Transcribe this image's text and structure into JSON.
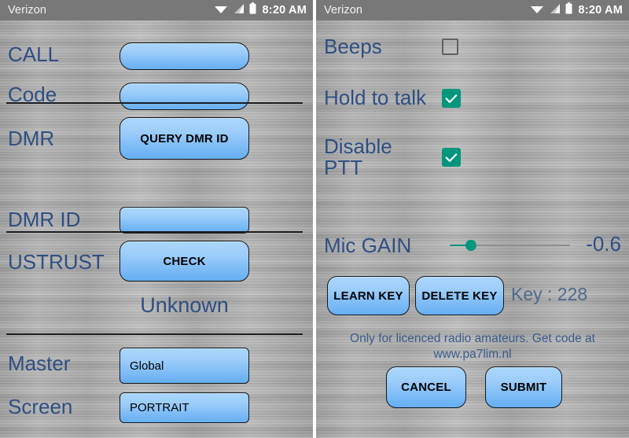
{
  "status_bar": {
    "carrier": "Verizon",
    "time": "8:20 AM",
    "icons": [
      "wifi-icon",
      "signal-icon",
      "battery-icon"
    ]
  },
  "left_panel": {
    "rows": [
      {
        "label": "CALL",
        "control": "text-field",
        "value": ""
      },
      {
        "label": "Code",
        "control": "text-field",
        "value": ""
      },
      {
        "label": "DMR",
        "control": "button",
        "value": "QUERY DMR ID"
      },
      {
        "label": "DMR ID",
        "control": "text-field",
        "value": ""
      },
      {
        "label": "USTRUST",
        "control": "button",
        "value": "CHECK"
      },
      {
        "label": "Master",
        "control": "spinner",
        "value": "Global"
      },
      {
        "label": "Screen",
        "control": "spinner",
        "value": "PORTRAIT"
      }
    ],
    "ustrust_status": "Unknown"
  },
  "right_panel": {
    "checkboxes": [
      {
        "label": "Beeps",
        "checked": false
      },
      {
        "label": "Hold to talk",
        "checked": true
      },
      {
        "label": "Disable\nPTT",
        "checked": true
      }
    ],
    "mic_gain": {
      "label": "Mic GAIN",
      "value": "-0.6"
    },
    "key_buttons": [
      {
        "label": "LEARN KEY"
      },
      {
        "label": "DELETE KEY"
      }
    ],
    "key_status": "Key : 228",
    "footnote_line1": "Only for licenced radio amateurs. Get code at",
    "footnote_line2": "www.pa7lim.nl",
    "actions": [
      {
        "label": "CANCEL"
      },
      {
        "label": "SUBMIT"
      }
    ]
  },
  "colors": {
    "label_blue": "#2f4f82",
    "control_blue": "#9ccdfa",
    "accent_teal": "#00967d",
    "statusbar_gray": "#787878"
  }
}
